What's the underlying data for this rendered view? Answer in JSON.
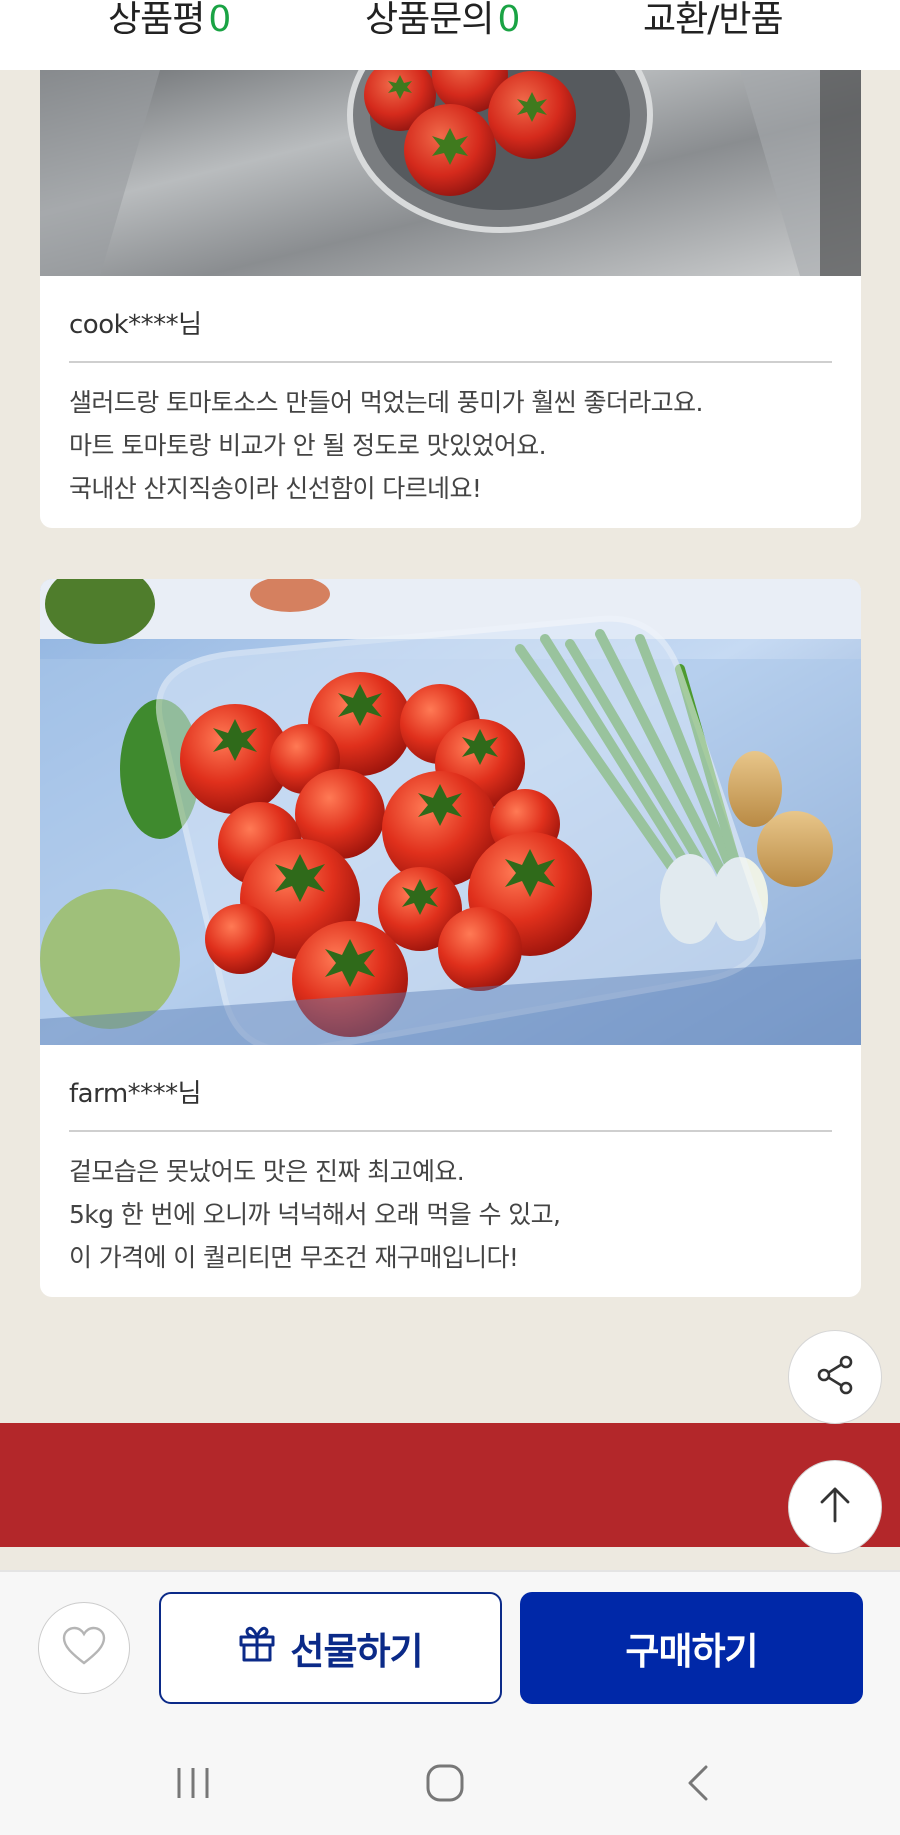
{
  "tabs": [
    {
      "label": "상품평",
      "count": "0"
    },
    {
      "label": "상품문의",
      "count": "0"
    },
    {
      "label": "교환/반품"
    }
  ],
  "reviews": [
    {
      "reviewer": "cook****님",
      "lines": [
        "샐러드랑 토마토소스 만들어 먹었는데 풍미가 훨씬 좋더라고요.",
        "마트 토마토랑 비교가 안 될 정도로 맛있었어요.",
        "국내산 산지직송이라 신선함이 다르네요!"
      ]
    },
    {
      "reviewer": "farm****님",
      "lines": [
        "겉모습은 못났어도 맛은 진짜 최고예요.",
        "5kg 한 번에 오니까 넉넉해서 오래 먹을 수 있고,",
        "이 가격에 이 퀄리티면 무조건 재구매입니다!"
      ]
    }
  ],
  "actions": {
    "gift_label": "선물하기",
    "buy_label": "구매하기"
  },
  "icons": {
    "share": "share-icon",
    "top": "arrow-up-icon",
    "wish": "heart-icon",
    "gift": "gift-icon"
  },
  "colors": {
    "tab_count": "#1aa344",
    "buy_button": "#0028a8",
    "gift_border": "#0b2a88",
    "banner": "#b3272a",
    "background": "#ede9e0"
  }
}
